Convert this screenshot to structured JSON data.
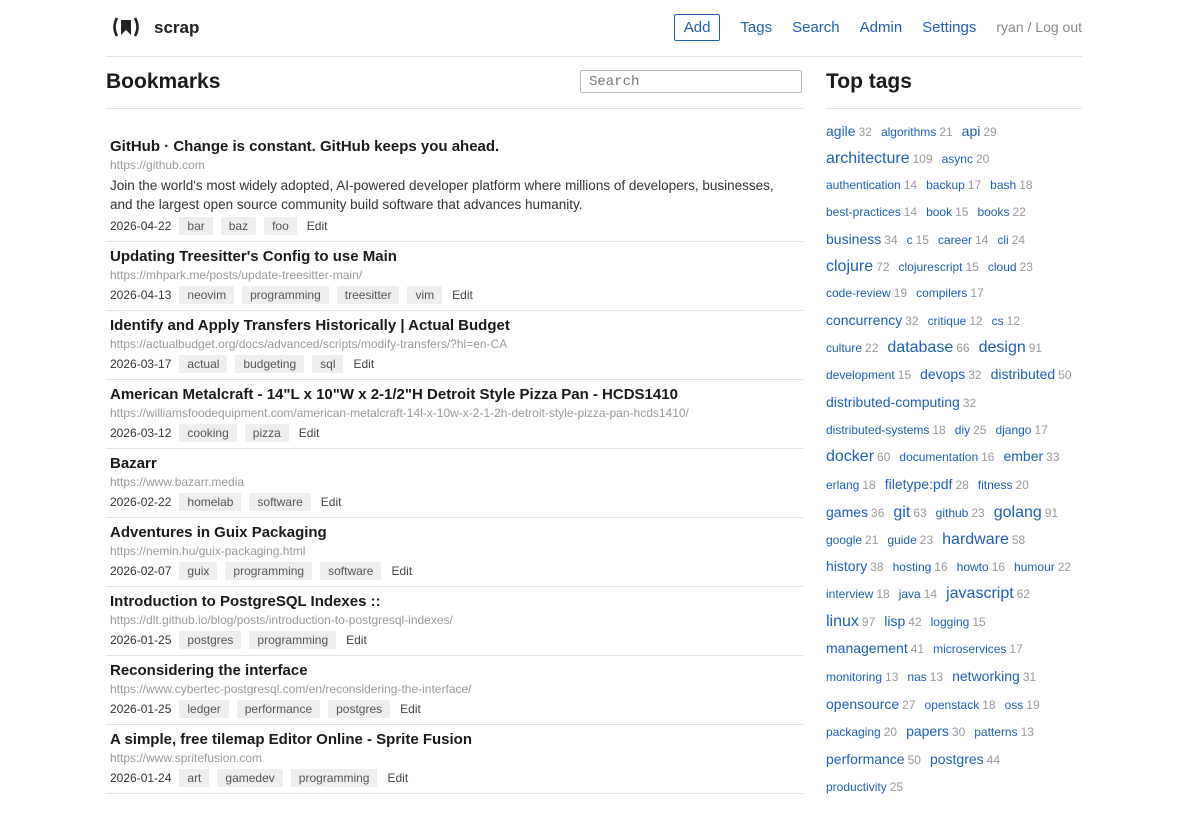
{
  "brand": "scrap",
  "nav": {
    "add": "Add",
    "tags": "Tags",
    "search": "Search",
    "admin": "Admin",
    "settings": "Settings",
    "user": "ryan",
    "sep": " / ",
    "logout": "Log out"
  },
  "main": {
    "title": "Bookmarks",
    "search_placeholder": "Search",
    "edit_label": "Edit"
  },
  "bookmarks": [
    {
      "title": "GitHub · Change is constant. GitHub keeps you ahead.",
      "url": "https://github.com",
      "desc": "Join the world's most widely adopted, AI-powered developer platform where millions of developers, businesses, and the largest open source community build software that advances humanity.",
      "date": "2026-04-22",
      "tags": [
        "bar",
        "baz",
        "foo"
      ]
    },
    {
      "title": "Updating Treesitter's Config to use Main",
      "url": "https://mhpark.me/posts/update-treesitter-main/",
      "desc": "",
      "date": "2026-04-13",
      "tags": [
        "neovim",
        "programming",
        "treesitter",
        "vim"
      ]
    },
    {
      "title": "Identify and Apply Transfers Historically | Actual Budget",
      "url": "https://actualbudget.org/docs/advanced/scripts/modify-transfers/?hl=en-CA",
      "desc": "",
      "date": "2026-03-17",
      "tags": [
        "actual",
        "budgeting",
        "sql"
      ]
    },
    {
      "title": "American Metalcraft - 14\"L x 10\"W x 2-1/2\"H Detroit Style Pizza Pan - HCDS1410",
      "url": "https://williamsfoodequipment.com/american-metalcraft-14l-x-10w-x-2-1-2h-detroit-style-pizza-pan-hcds1410/",
      "desc": "",
      "date": "2026-03-12",
      "tags": [
        "cooking",
        "pizza"
      ]
    },
    {
      "title": "Bazarr",
      "url": "https://www.bazarr.media",
      "desc": "",
      "date": "2026-02-22",
      "tags": [
        "homelab",
        "software"
      ]
    },
    {
      "title": "Adventures in Guix Packaging",
      "url": "https://nemin.hu/guix-packaging.html",
      "desc": "",
      "date": "2026-02-07",
      "tags": [
        "guix",
        "programming",
        "software"
      ]
    },
    {
      "title": "Introduction to PostgreSQL Indexes ::",
      "url": "https://dlt.github.io/blog/posts/introduction-to-postgresql-indexes/",
      "desc": "",
      "date": "2026-01-25",
      "tags": [
        "postgres",
        "programming"
      ]
    },
    {
      "title": "Reconsidering the interface",
      "url": "https://www.cybertec-postgresql.com/en/reconsidering-the-interface/",
      "desc": "",
      "date": "2026-01-25",
      "tags": [
        "ledger",
        "performance",
        "postgres"
      ]
    },
    {
      "title": "A simple, free tilemap Editor Online - Sprite Fusion",
      "url": "https://www.spritefusion.com",
      "desc": "",
      "date": "2026-01-24",
      "tags": [
        "art",
        "gamedev",
        "programming"
      ]
    }
  ],
  "sidebar": {
    "title": "Top tags",
    "tags": [
      {
        "name": "agile",
        "count": "32",
        "size": 2
      },
      {
        "name": "algorithms",
        "count": "21",
        "size": 1
      },
      {
        "name": "api",
        "count": "29",
        "size": 2
      },
      {
        "name": "architecture",
        "count": "109",
        "size": 3
      },
      {
        "name": "async",
        "count": "20",
        "size": 1
      },
      {
        "name": "authentication",
        "count": "14",
        "size": 1
      },
      {
        "name": "backup",
        "count": "17",
        "size": 1
      },
      {
        "name": "bash",
        "count": "18",
        "size": 1
      },
      {
        "name": "best-practices",
        "count": "14",
        "size": 1
      },
      {
        "name": "book",
        "count": "15",
        "size": 1
      },
      {
        "name": "books",
        "count": "22",
        "size": 1
      },
      {
        "name": "business",
        "count": "34",
        "size": 2
      },
      {
        "name": "c",
        "count": "15",
        "size": 1
      },
      {
        "name": "career",
        "count": "14",
        "size": 1
      },
      {
        "name": "cli",
        "count": "24",
        "size": 1
      },
      {
        "name": "clojure",
        "count": "72",
        "size": 3
      },
      {
        "name": "clojurescript",
        "count": "15",
        "size": 1
      },
      {
        "name": "cloud",
        "count": "23",
        "size": 1
      },
      {
        "name": "code-review",
        "count": "19",
        "size": 1
      },
      {
        "name": "compilers",
        "count": "17",
        "size": 1
      },
      {
        "name": "concurrency",
        "count": "32",
        "size": 2
      },
      {
        "name": "critique",
        "count": "12",
        "size": 1
      },
      {
        "name": "cs",
        "count": "12",
        "size": 1
      },
      {
        "name": "culture",
        "count": "22",
        "size": 1
      },
      {
        "name": "database",
        "count": "66",
        "size": 3
      },
      {
        "name": "design",
        "count": "91",
        "size": 3
      },
      {
        "name": "development",
        "count": "15",
        "size": 1
      },
      {
        "name": "devops",
        "count": "32",
        "size": 2
      },
      {
        "name": "distributed",
        "count": "50",
        "size": 2
      },
      {
        "name": "distributed-computing",
        "count": "32",
        "size": 2
      },
      {
        "name": "distributed-systems",
        "count": "18",
        "size": 1
      },
      {
        "name": "diy",
        "count": "25",
        "size": 1
      },
      {
        "name": "django",
        "count": "17",
        "size": 1
      },
      {
        "name": "docker",
        "count": "60",
        "size": 3
      },
      {
        "name": "documentation",
        "count": "16",
        "size": 1
      },
      {
        "name": "ember",
        "count": "33",
        "size": 2
      },
      {
        "name": "erlang",
        "count": "18",
        "size": 1
      },
      {
        "name": "filetype:pdf",
        "count": "28",
        "size": 2
      },
      {
        "name": "fitness",
        "count": "20",
        "size": 1
      },
      {
        "name": "games",
        "count": "36",
        "size": 2
      },
      {
        "name": "git",
        "count": "63",
        "size": 3
      },
      {
        "name": "github",
        "count": "23",
        "size": 1
      },
      {
        "name": "golang",
        "count": "91",
        "size": 3
      },
      {
        "name": "google",
        "count": "21",
        "size": 1
      },
      {
        "name": "guide",
        "count": "23",
        "size": 1
      },
      {
        "name": "hardware",
        "count": "58",
        "size": 3
      },
      {
        "name": "history",
        "count": "38",
        "size": 2
      },
      {
        "name": "hosting",
        "count": "16",
        "size": 1
      },
      {
        "name": "howto",
        "count": "16",
        "size": 1
      },
      {
        "name": "humour",
        "count": "22",
        "size": 1
      },
      {
        "name": "interview",
        "count": "18",
        "size": 1
      },
      {
        "name": "java",
        "count": "14",
        "size": 1
      },
      {
        "name": "javascript",
        "count": "62",
        "size": 3
      },
      {
        "name": "linux",
        "count": "97",
        "size": 3
      },
      {
        "name": "lisp",
        "count": "42",
        "size": 2
      },
      {
        "name": "logging",
        "count": "15",
        "size": 1
      },
      {
        "name": "management",
        "count": "41",
        "size": 2
      },
      {
        "name": "microservices",
        "count": "17",
        "size": 1
      },
      {
        "name": "monitoring",
        "count": "13",
        "size": 1
      },
      {
        "name": "nas",
        "count": "13",
        "size": 1
      },
      {
        "name": "networking",
        "count": "31",
        "size": 2
      },
      {
        "name": "opensource",
        "count": "27",
        "size": 2
      },
      {
        "name": "openstack",
        "count": "18",
        "size": 1
      },
      {
        "name": "oss",
        "count": "19",
        "size": 1
      },
      {
        "name": "packaging",
        "count": "20",
        "size": 1
      },
      {
        "name": "papers",
        "count": "30",
        "size": 2
      },
      {
        "name": "patterns",
        "count": "13",
        "size": 1
      },
      {
        "name": "performance",
        "count": "50",
        "size": 2
      },
      {
        "name": "postgres",
        "count": "44",
        "size": 2
      },
      {
        "name": "productivity",
        "count": "25",
        "size": 1
      }
    ]
  },
  "colors": {
    "link": "#1f5fb4",
    "muted": "#999999",
    "tag_bg": "#eeeeee"
  }
}
